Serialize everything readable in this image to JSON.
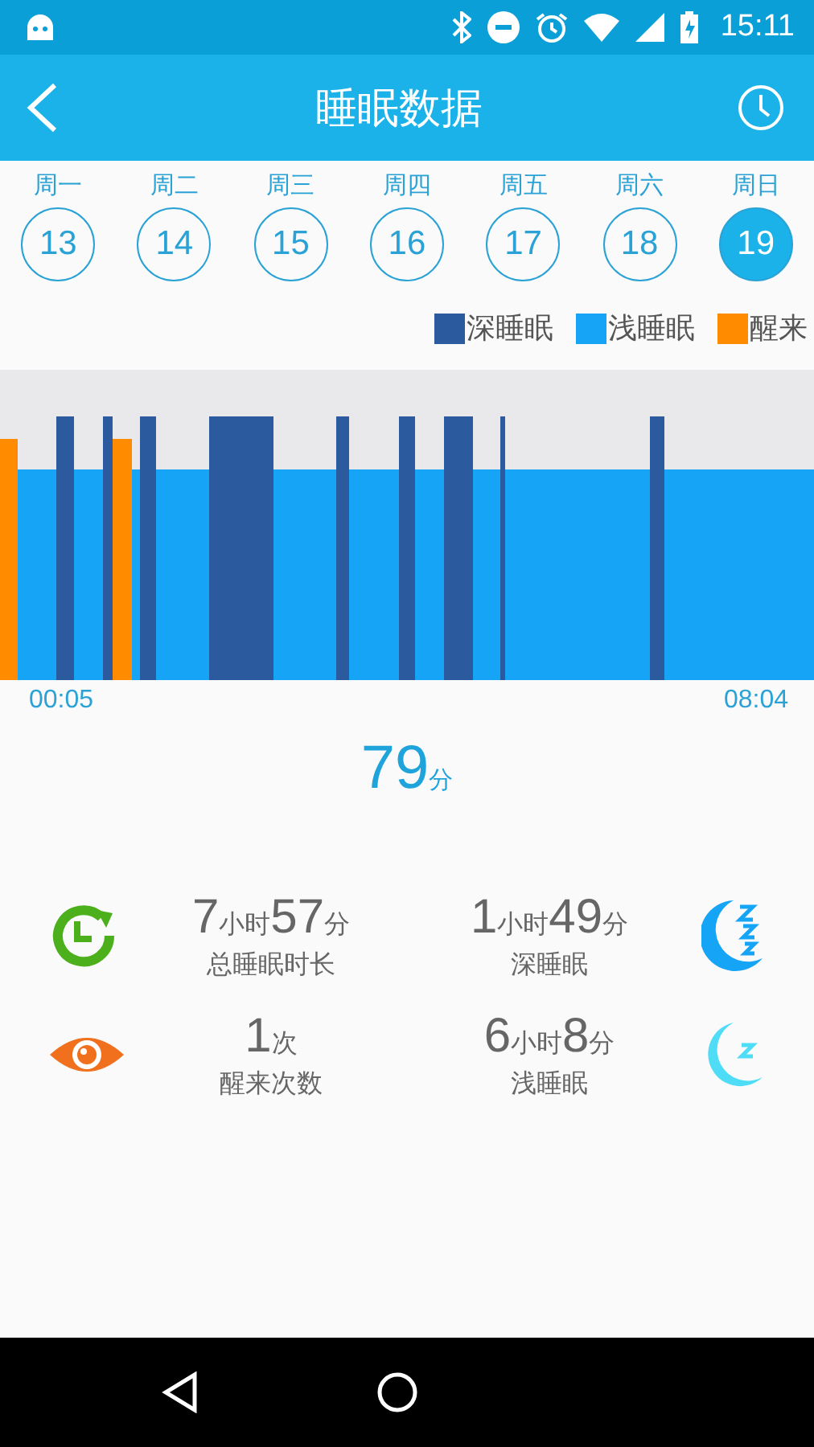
{
  "status_bar": {
    "time": "15:11"
  },
  "app_bar": {
    "title": "睡眠数据"
  },
  "days": [
    {
      "weekday": "周一",
      "date": "13",
      "selected": false
    },
    {
      "weekday": "周二",
      "date": "14",
      "selected": false
    },
    {
      "weekday": "周三",
      "date": "15",
      "selected": false
    },
    {
      "weekday": "周四",
      "date": "16",
      "selected": false
    },
    {
      "weekday": "周五",
      "date": "17",
      "selected": false
    },
    {
      "weekday": "周六",
      "date": "18",
      "selected": false
    },
    {
      "weekday": "周日",
      "date": "19",
      "selected": true
    }
  ],
  "legend": [
    {
      "label": "深睡眠",
      "color": "#2c5a9e"
    },
    {
      "label": "浅睡眠",
      "color": "#16a4f7"
    },
    {
      "label": "醒来",
      "color": "#ff8c00"
    }
  ],
  "chart": {
    "start_time": "00:05",
    "end_time": "08:04"
  },
  "score": {
    "value": "79",
    "unit": "分"
  },
  "stats": [
    {
      "kind": "total",
      "parts": [
        {
          "num": "7",
          "unit": "小时"
        },
        {
          "num": "57",
          "unit": "分"
        }
      ],
      "label": "总睡眠时长"
    },
    {
      "kind": "deep",
      "parts": [
        {
          "num": "1",
          "unit": "小时"
        },
        {
          "num": "49",
          "unit": "分"
        }
      ],
      "label": "深睡眠"
    },
    {
      "kind": "wake",
      "parts": [
        {
          "num": "1",
          "unit": "次"
        }
      ],
      "label": "醒来次数"
    },
    {
      "kind": "light",
      "parts": [
        {
          "num": "6",
          "unit": "小时"
        },
        {
          "num": "8",
          "unit": "分"
        }
      ],
      "label": "浅睡眠"
    }
  ]
}
